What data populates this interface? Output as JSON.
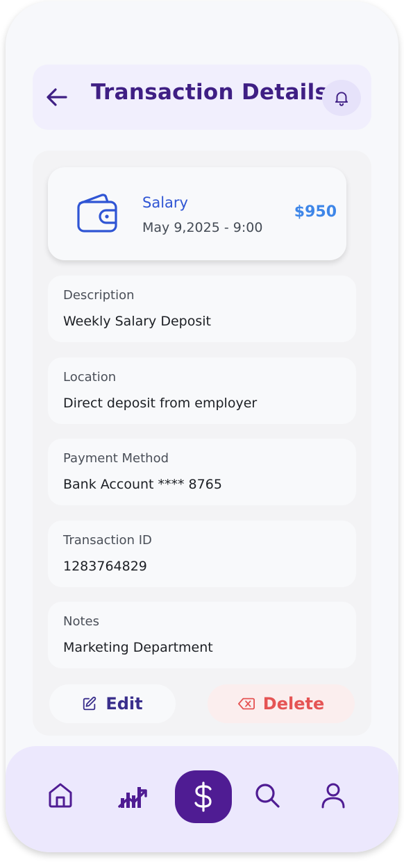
{
  "header": {
    "title": "Transaction Details"
  },
  "summary": {
    "title": "Salary",
    "date": "May 9,2025 - 9:00",
    "amount": "$950"
  },
  "fields": [
    {
      "label": "Description",
      "value": "Weekly Salary Deposit"
    },
    {
      "label": "Location",
      "value": "Direct deposit from employer"
    },
    {
      "label": "Payment Method",
      "value": "Bank Account **** 8765"
    },
    {
      "label": "Transaction ID",
      "value": "1283764829"
    },
    {
      "label": "Notes",
      "value": "Marketing Department"
    }
  ],
  "actions": {
    "edit_label": "Edit",
    "delete_label": "Delete"
  },
  "nav": {
    "items": [
      "home-icon",
      "chart-icon",
      "dollar-icon",
      "search-icon",
      "user-icon"
    ],
    "active": "dollar-icon"
  },
  "colors": {
    "accent": "#4f1c93",
    "title": "#3f1f84",
    "amount": "#3e86e8",
    "delete": "#e55454"
  }
}
